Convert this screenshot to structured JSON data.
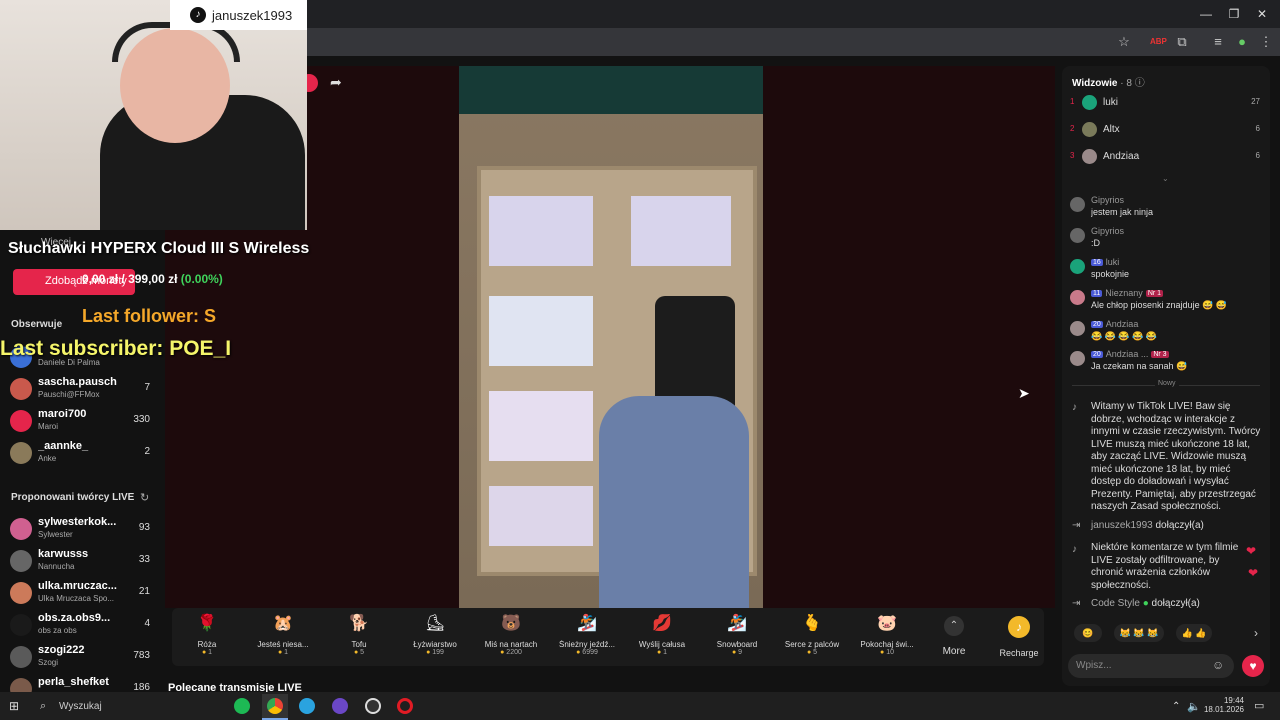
{
  "overlay": {
    "tiktok_handle": "januszek1993",
    "product_title": "Słuchawki HYPERX Cloud III S Wireless",
    "goal_current": "0,00 zł",
    "goal_separator": "/",
    "goal_target": "399,00 zł",
    "goal_percent": "(0.00%)",
    "last_follower": "Last follower: S",
    "last_subscriber": "Last subscriber: POE_I",
    "behind_text_more": "Więcej",
    "behind_button": "Zdobądź monety"
  },
  "sidebar": {
    "following_title": "Obserwuje",
    "following": [
      {
        "name": "",
        "sub": "Daniele Di Palma",
        "count": ""
      },
      {
        "name": "sascha.pausch",
        "sub": "Pauschi@FFMox",
        "count": "7"
      },
      {
        "name": "maroi700",
        "sub": "Maroi",
        "count": "330"
      },
      {
        "name": "_aannke_",
        "sub": "Anke",
        "count": "2"
      }
    ],
    "suggested_title": "Proponowani twórcy LIVE",
    "suggested": [
      {
        "name": "sylwesterkok...",
        "sub": "Sylwester",
        "count": "93"
      },
      {
        "name": "karwusss",
        "sub": "Nannucha",
        "count": "33"
      },
      {
        "name": "ulka.mruczac...",
        "sub": "Ulka Mruczaca Spo...",
        "count": "21"
      },
      {
        "name": "obs.za.obs9...",
        "sub": "obs za obs",
        "count": "4"
      },
      {
        "name": "szogi222",
        "sub": "Szogi",
        "count": "783"
      },
      {
        "name": "perla_shefket",
        "sub": "",
        "count": "186"
      }
    ]
  },
  "main": {
    "recommended_title": "Polecane transmisje LIVE"
  },
  "gifts": [
    {
      "name": "Róża",
      "price": "1",
      "icon": "🌹"
    },
    {
      "name": "Jesteś niesa...",
      "price": "1",
      "icon": "🐹"
    },
    {
      "name": "Tofu",
      "price": "5",
      "icon": "🐕"
    },
    {
      "name": "Łyżwiarstwo",
      "price": "199",
      "icon": "⛸"
    },
    {
      "name": "Miś na nartach",
      "price": "2200",
      "icon": "🐻"
    },
    {
      "name": "Śnieżny jeźdź...",
      "price": "6999",
      "icon": "🏂"
    },
    {
      "name": "Wyślij całusa",
      "price": "1",
      "icon": "💋"
    },
    {
      "name": "Snowboard",
      "price": "9",
      "icon": "🏂"
    },
    {
      "name": "Serce z palców",
      "price": "5",
      "icon": "🫰"
    },
    {
      "name": "Pokochaj świ...",
      "price": "10",
      "icon": "🐷"
    }
  ],
  "gift_more": "More",
  "recharge": "Recharge",
  "chat": {
    "viewers_title": "Widzowie",
    "viewers_count": "· 8",
    "top": [
      {
        "rank": "1",
        "name": "luki",
        "score": "27",
        "color": "#1aa37a"
      },
      {
        "rank": "2",
        "name": "Altx",
        "score": "6",
        "color": "#7a7a5a"
      },
      {
        "rank": "3",
        "name": "Andziaa",
        "score": "6",
        "color": "#9a8a8a"
      }
    ],
    "messages": [
      {
        "user": "Gipyrios",
        "text": "jestem jak ninja"
      },
      {
        "user": "Gipyrios",
        "text": ":D"
      },
      {
        "user": "luki",
        "level": "16",
        "text": "spokojnie"
      },
      {
        "user": "Nieznany",
        "level": "11",
        "rank_badge": "Nr 1",
        "text": "Ale chłop piosenki znajduje 😅 😅"
      },
      {
        "user": "Andziaa",
        "level": "20",
        "text": "😂 😂 😂 😂 😂"
      },
      {
        "user": "Andziaa ...",
        "level": "20",
        "rank_badge": "Nr 3",
        "text": "Ja czekam na sanah 😅"
      }
    ],
    "new_divider": "Nowy",
    "system_welcome": "Witamy w TikTok LIVE! Baw się dobrze, wchodząc w interakcje z innymi w czasie rzeczywistym. Twórcy LIVE muszą mieć ukończone 18 lat, aby zacząć LIVE. Widzowie muszą mieć ukończone 18 lat, by mieć dostęp do doładowań i wysyłać Prezenty. Pamiętaj, aby przestrzegać naszych Zasad społeczności.",
    "join1_user": "januszek1993",
    "join1_text": "dołączył(a)",
    "system_filter": "Niektóre komentarze w tym filmie LIVE zostały odfiltrowane, by chronić wrażenia członków społeczności.",
    "join2_user": "Code Style",
    "join2_text": "dołączył(a)",
    "quick_reactions": [
      "😊",
      "😹 😹 😹",
      "👍 👍"
    ],
    "input_placeholder": "Wpisz..."
  },
  "taskbar": {
    "search_placeholder": "Wyszukaj",
    "time": "19:44",
    "date": "18.01.2026"
  }
}
